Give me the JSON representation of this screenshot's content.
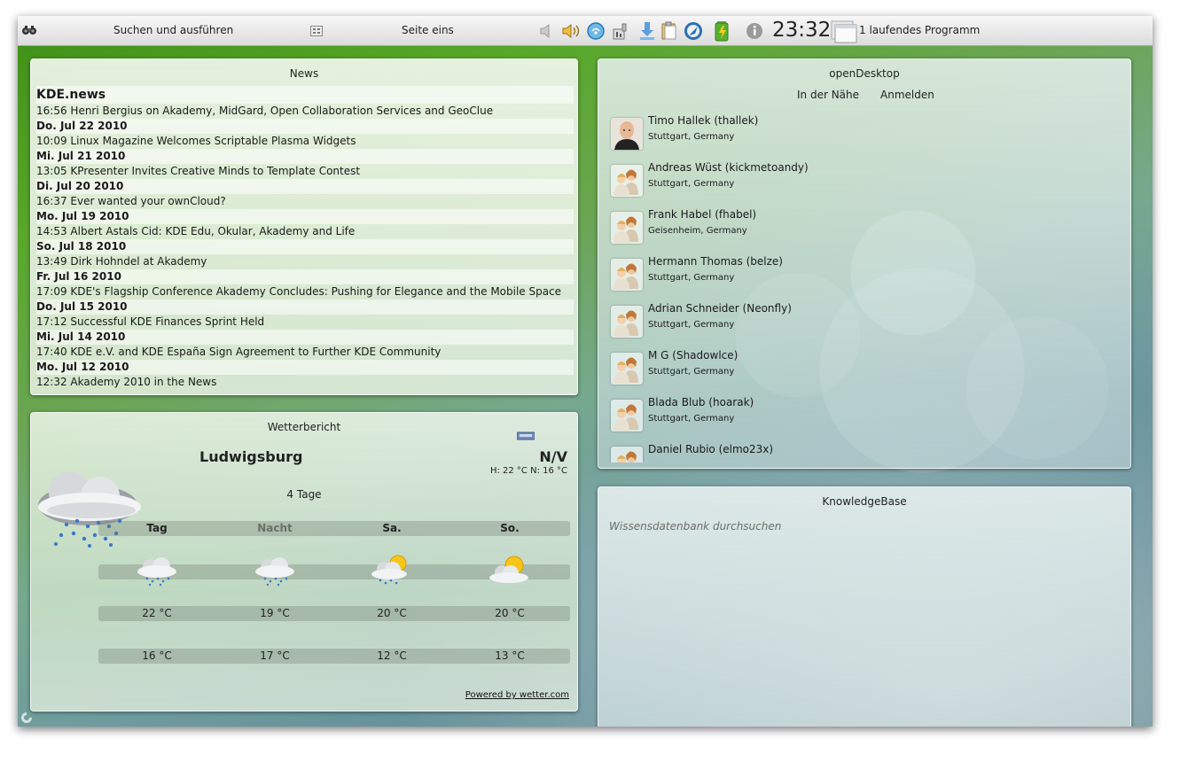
{
  "panel": {
    "runner_label": "Suchen und ausführen",
    "activity_label": "Seite eins",
    "clock": "23:32",
    "tasks_label": "1 laufendes Programm"
  },
  "news": {
    "title": "News",
    "source": "KDE.news",
    "items": [
      {
        "time": "16:56",
        "text": "Henri Bergius on Akademy, MidGard, Open Collaboration Services and GeoClue"
      },
      {
        "date": "Do. Jul 22 2010"
      },
      {
        "time": "10:09",
        "text": "Linux Magazine Welcomes Scriptable Plasma Widgets"
      },
      {
        "date": "Mi. Jul 21 2010"
      },
      {
        "time": "13:05",
        "text": "KPresenter Invites Creative Minds to Template Contest"
      },
      {
        "date": "Di. Jul 20 2010"
      },
      {
        "time": "16:37",
        "text": "Ever wanted your ownCloud?"
      },
      {
        "date": "Mo. Jul 19 2010"
      },
      {
        "time": "14:53",
        "text": "Albert Astals Cid: KDE Edu, Okular, Akademy and Life"
      },
      {
        "date": "So. Jul 18 2010"
      },
      {
        "time": "13:49",
        "text": "Dirk Hohndel at Akademy"
      },
      {
        "date": "Fr. Jul 16 2010"
      },
      {
        "time": "17:09",
        "text": "KDE's Flagship Conference Akademy Concludes: Pushing for Elegance and the Mobile Space"
      },
      {
        "date": "Do. Jul 15 2010"
      },
      {
        "time": "17:12",
        "text": "Successful KDE Finances Sprint Held"
      },
      {
        "date": "Mi. Jul 14 2010"
      },
      {
        "time": "17:40",
        "text": "KDE e.V. and KDE España Sign Agreement to Further KDE Community"
      },
      {
        "date": "Mo. Jul 12 2010"
      },
      {
        "time": "12:32",
        "text": "Akademy 2010 in the News"
      }
    ]
  },
  "weather": {
    "title": "Wetterbericht",
    "city": "Ludwigsburg",
    "condition": "N/V",
    "hilo": "H: 22 °C N: 16 °C",
    "days_label": "4 Tage",
    "powered": "Powered by wetter.com",
    "columns": [
      {
        "label": "Tag",
        "icon": "rain-cloud-icon",
        "high": "22 °C",
        "low": "16 °C"
      },
      {
        "label": "Nacht",
        "icon": "rain-cloud-icon",
        "high": "19 °C",
        "low": "17 °C"
      },
      {
        "label": "Sa.",
        "icon": "sun-rain-cloud-icon",
        "high": "20 °C",
        "low": "12 °C"
      },
      {
        "label": "So.",
        "icon": "sun-cloud-icon",
        "high": "20 °C",
        "low": "13 °C"
      }
    ]
  },
  "opendesktop": {
    "title": "openDesktop",
    "tab_nearby": "In der Nähe",
    "tab_login": "Anmelden",
    "people": [
      {
        "name": "Timo Hallek (thallek)",
        "location": "Stuttgart, Germany",
        "avatar": "photo"
      },
      {
        "name": "Andreas Wüst (kickmetoandy)",
        "location": "Stuttgart, Germany",
        "avatar": "default-user-icon"
      },
      {
        "name": "Frank Habel (fhabel)",
        "location": "Geisenheim, Germany",
        "avatar": "default-user-icon"
      },
      {
        "name": "Hermann Thomas (belze)",
        "location": "Stuttgart, Germany",
        "avatar": "default-user-icon"
      },
      {
        "name": "Adrian Schneider (Neonfly)",
        "location": "Stuttgart, Germany",
        "avatar": "default-user-icon"
      },
      {
        "name": "M G (Shadowlce)",
        "location": "Stuttgart, Germany",
        "avatar": "default-user-icon"
      },
      {
        "name": "Blada Blub (hoarak)",
        "location": "Stuttgart, Germany",
        "avatar": "default-user-icon"
      },
      {
        "name": "Daniel Rubio (elmo23x)",
        "location": "",
        "avatar": "default-user-icon"
      }
    ]
  },
  "knowledgebase": {
    "title": "KnowledgeBase",
    "search_placeholder": "Wissensdatenbank durchsuchen"
  }
}
